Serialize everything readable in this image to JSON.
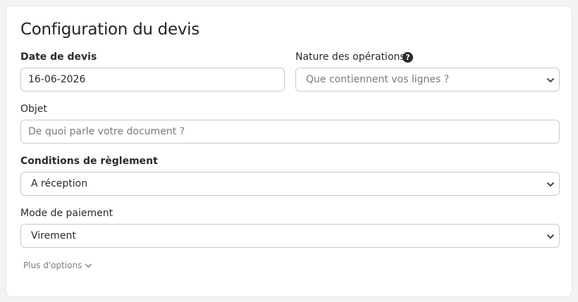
{
  "title": "Configuration du devis",
  "date": {
    "label": "Date de devis",
    "value": "16-06-2026"
  },
  "nature": {
    "label": "Nature des opérations",
    "help_icon": "question-circle-icon",
    "placeholder": "Que contiennent vos lignes ?"
  },
  "objet": {
    "label": "Objet",
    "placeholder": "De quoi parle votre document ?"
  },
  "conditions": {
    "label": "Conditions de règlement",
    "value": "A réception"
  },
  "paiement": {
    "label": "Mode de paiement",
    "value": "Virement"
  },
  "more_options": {
    "label": "Plus d'options",
    "icon": "chevron-down-icon"
  }
}
